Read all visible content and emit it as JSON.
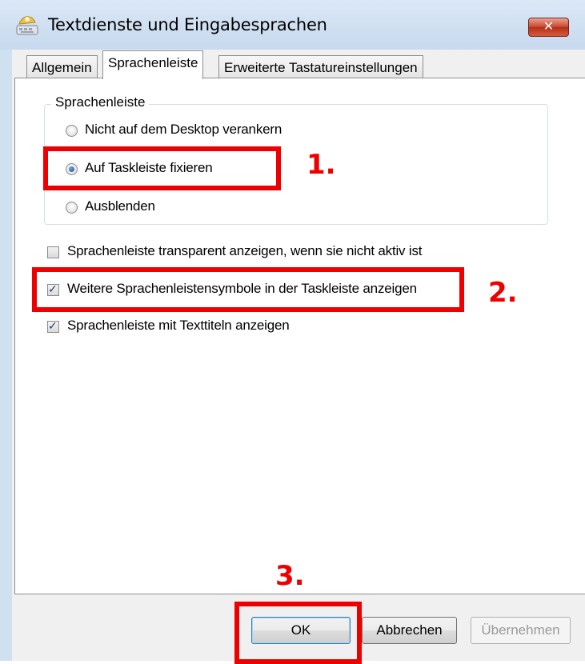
{
  "window": {
    "title": "Textdienste und Eingabesprachen",
    "close_label": "✕"
  },
  "tabs": [
    {
      "label": "Allgemein",
      "active": false
    },
    {
      "label": "Sprachenleiste",
      "active": true
    },
    {
      "label": "Erweiterte Tastatureinstellungen",
      "active": false
    }
  ],
  "group": {
    "title": "Sprachenleiste",
    "options": [
      {
        "label": "Nicht auf dem Desktop verankern",
        "checked": false
      },
      {
        "label": "Auf Taskleiste fixieren",
        "checked": true
      },
      {
        "label": "Ausblenden",
        "checked": false
      }
    ]
  },
  "checkboxes": [
    {
      "label": "Sprachenleiste transparent anzeigen, wenn sie nicht aktiv ist",
      "checked": false
    },
    {
      "label": "Weitere Sprachenleistensymbole in der Taskleiste anzeigen",
      "checked": true
    },
    {
      "label": "Sprachenleiste mit Texttiteln anzeigen",
      "checked": true
    }
  ],
  "buttons": {
    "ok": "OK",
    "cancel": "Abbrechen",
    "apply": "Übernehmen",
    "apply_enabled": false
  },
  "annotations": {
    "step1": "1.",
    "step2": "2.",
    "step3": "3.",
    "color": "#ee0000"
  }
}
